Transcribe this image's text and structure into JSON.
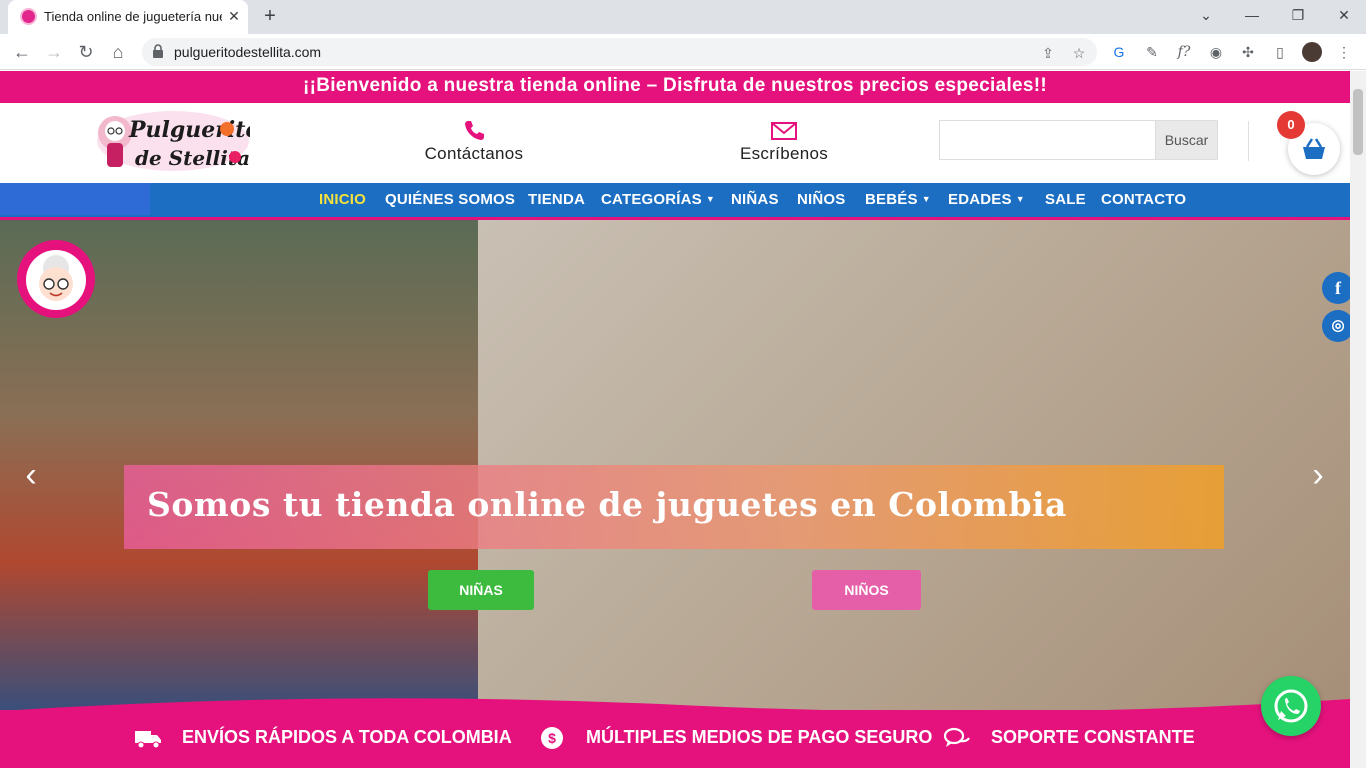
{
  "browser": {
    "tab_title": "Tienda online de juguetería nuev",
    "url": "pulgueritodestellita.com",
    "tab_close": "✕",
    "new_tab": "+"
  },
  "site": {
    "promo_text": "¡¡Bienvenido a nuestra tienda online – Disfruta de nuestros precios especiales!!",
    "logo_text_1": "Pulguerito",
    "logo_text_2": "de Stellita",
    "contact_label": "Contáctanos",
    "email_label": "Escríbenos",
    "search_button": "Buscar",
    "search_placeholder": "",
    "cart_count": "0",
    "nav": [
      {
        "label": "INICIO"
      },
      {
        "label": "QUIÉNES SOMOS"
      },
      {
        "label": "TIENDA"
      },
      {
        "label": "CATEGORÍAS"
      },
      {
        "label": "NIÑAS"
      },
      {
        "label": "NIÑOS"
      },
      {
        "label": "BEBÉS"
      },
      {
        "label": "EDADES"
      },
      {
        "label": "SALE"
      },
      {
        "label": "CONTACTO"
      }
    ],
    "hero": {
      "headline": "Somos tu tienda online de juguetes en Colombia",
      "btn_girls": "NIÑAS",
      "btn_boys": "NIÑOS"
    },
    "benefits": [
      {
        "label": "ENVÍOS RÁPIDOS A TODA COLOMBIA",
        "icon": "truck-icon"
      },
      {
        "label": "MÚLTIPLES MEDIOS DE PAGO SEGURO",
        "icon": "payment-icon"
      },
      {
        "label": "SOPORTE CONSTANTE",
        "icon": "chat-icon"
      }
    ]
  },
  "colors": {
    "brand_pink": "#e5127d",
    "nav_blue": "#1b6ec2",
    "active_nav": "#f5e23a",
    "girls_green": "#3dbb3e",
    "boys_pink": "#e55fa8",
    "whatsapp_green": "#25d366"
  }
}
